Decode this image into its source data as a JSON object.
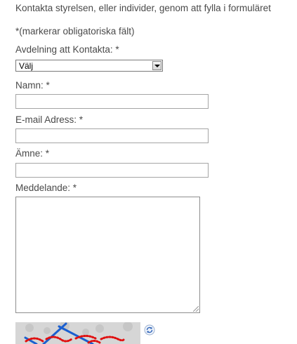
{
  "form": {
    "intro_text": "Kontakta styrelsen, eller individer, genom att fylla i formuläret",
    "required_note": "*(markerar obligatoriska fält)",
    "department": {
      "label": "Avdelning att Kontakta: *",
      "selected": "Välj"
    },
    "name": {
      "label": "Namn: *",
      "value": ""
    },
    "email": {
      "label": "E-mail Adress: *",
      "value": ""
    },
    "subject": {
      "label": "Ämne: *",
      "value": ""
    },
    "message": {
      "label": "Meddelande: *",
      "value": ""
    }
  },
  "icons": {
    "dropdown": "chevron-down-icon",
    "refresh": "refresh-icon"
  },
  "colors": {
    "text": "#4a4a4a",
    "captcha_red": "#e01010",
    "captcha_blue": "#1a5fd0"
  }
}
